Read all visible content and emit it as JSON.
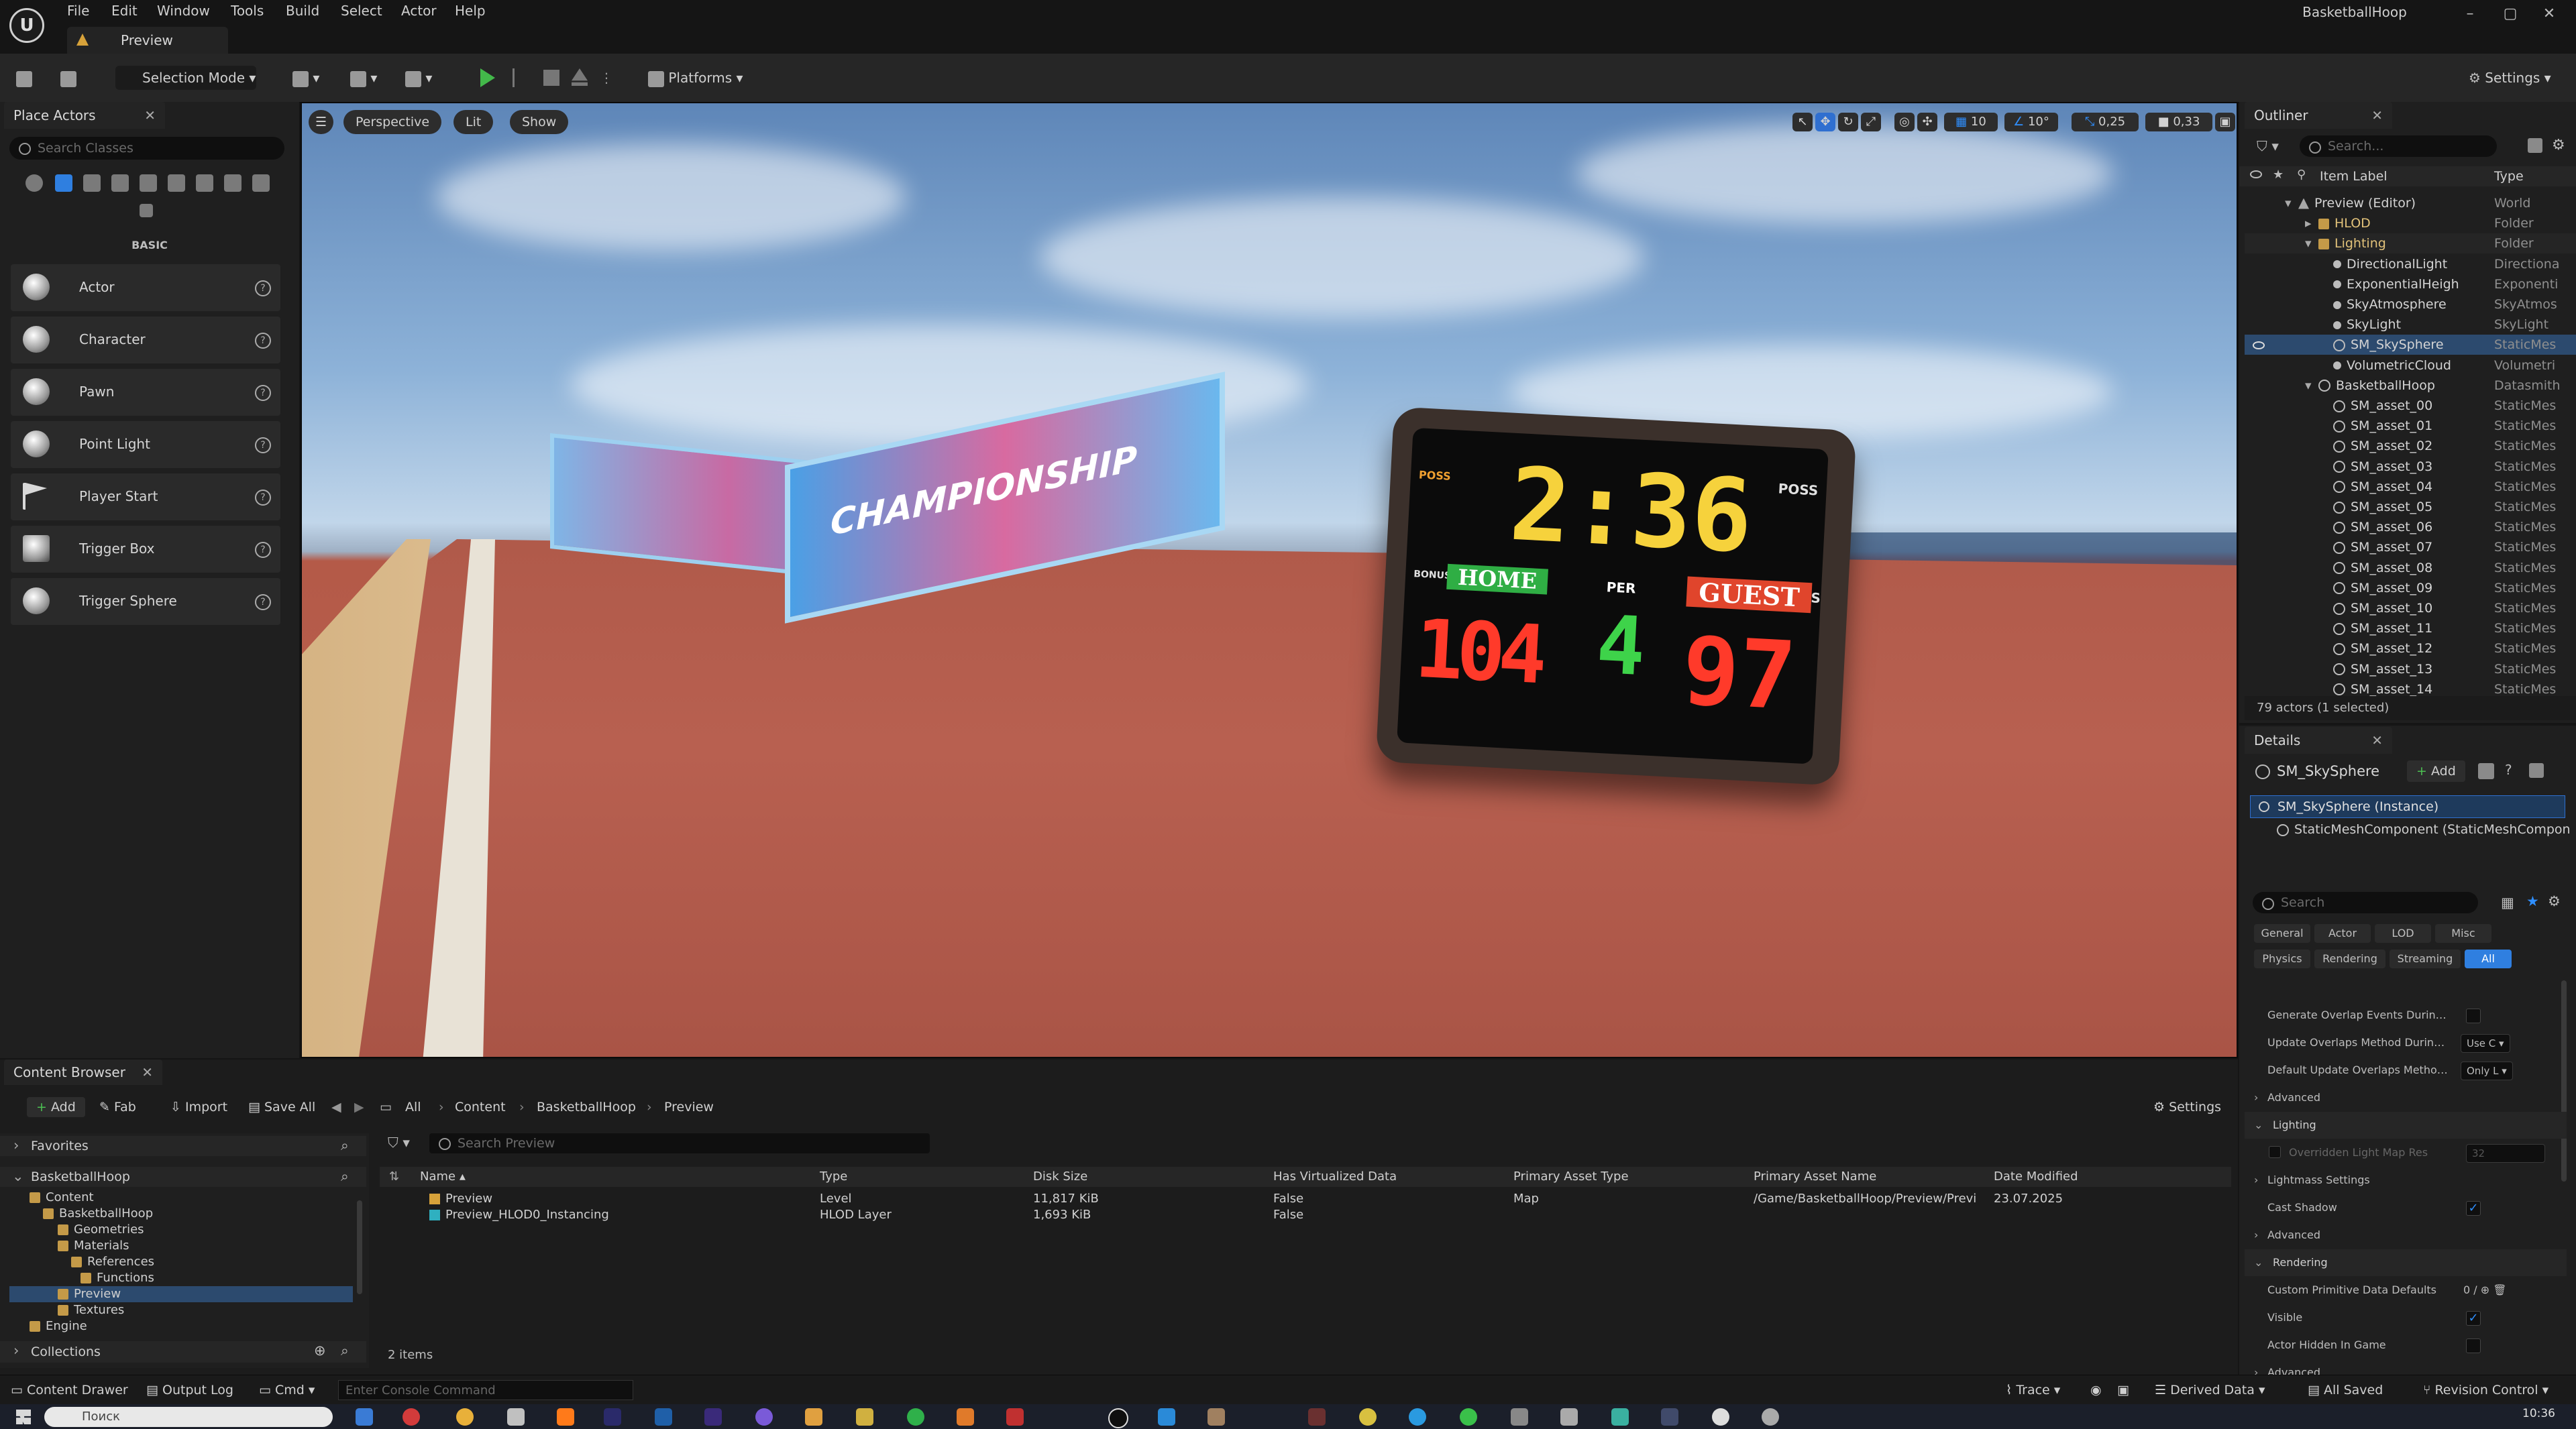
{
  "menu": [
    "File",
    "Edit",
    "Window",
    "Tools",
    "Build",
    "Select",
    "Actor",
    "Help"
  ],
  "level_tab": "Preview",
  "project_name": "BasketballHoop",
  "window_controls": [
    "–",
    "▢",
    "✕"
  ],
  "toolbar": {
    "selection_mode": "Selection Mode",
    "platforms": "Platforms",
    "settings": "Settings"
  },
  "place_actors": {
    "tab": "Place Actors",
    "search_placeholder": "Search Classes",
    "category": "BASIC",
    "items": [
      "Actor",
      "Character",
      "Pawn",
      "Point Light",
      "Player Start",
      "Trigger Box",
      "Trigger Sphere"
    ]
  },
  "viewport": {
    "view_mode": "Perspective",
    "lighting": "Lit",
    "show": "Show",
    "grid_snap": "10",
    "rotation_snap": "10°",
    "scale_snap": "0,25",
    "camera_speed": "0,33",
    "banner_text": "CHAMPIONSHIP",
    "scoreboard": {
      "clock": "2:36",
      "home_label": "HOME",
      "guest_label": "GUEST",
      "period_label": "PER",
      "period": "4",
      "home_score": "104",
      "guest_score": "97",
      "poss": "POSS",
      "bonus": "BONUS"
    }
  },
  "outliner": {
    "tab": "Outliner",
    "search_placeholder": "Search...",
    "col_label": "Item Label",
    "col_type": "Type",
    "rows": [
      {
        "name": "Preview (Editor)",
        "type": "World"
      },
      {
        "name": "HLOD",
        "type": "Folder"
      },
      {
        "name": "Lighting",
        "type": "Folder"
      },
      {
        "name": "DirectionalLight",
        "type": "Directiona"
      },
      {
        "name": "ExponentialHeigh",
        "type": "Exponenti"
      },
      {
        "name": "SkyAtmosphere",
        "type": "SkyAtmos"
      },
      {
        "name": "SkyLight",
        "type": "SkyLight"
      },
      {
        "name": "SM_SkySphere",
        "type": "StaticMes"
      },
      {
        "name": "VolumetricCloud",
        "type": "Volumetri"
      },
      {
        "name": "BasketballHoop",
        "type": "Datasmith"
      },
      {
        "name": "SM_asset_00",
        "type": "StaticMes"
      },
      {
        "name": "SM_asset_01",
        "type": "StaticMes"
      },
      {
        "name": "SM_asset_02",
        "type": "StaticMes"
      },
      {
        "name": "SM_asset_03",
        "type": "StaticMes"
      },
      {
        "name": "SM_asset_04",
        "type": "StaticMes"
      },
      {
        "name": "SM_asset_05",
        "type": "StaticMes"
      },
      {
        "name": "SM_asset_06",
        "type": "StaticMes"
      },
      {
        "name": "SM_asset_07",
        "type": "StaticMes"
      },
      {
        "name": "SM_asset_08",
        "type": "StaticMes"
      },
      {
        "name": "SM_asset_09",
        "type": "StaticMes"
      },
      {
        "name": "SM_asset_10",
        "type": "StaticMes"
      },
      {
        "name": "SM_asset_11",
        "type": "StaticMes"
      },
      {
        "name": "SM_asset_12",
        "type": "StaticMes"
      },
      {
        "name": "SM_asset_13",
        "type": "StaticMes"
      },
      {
        "name": "SM_asset_14",
        "type": "StaticMes"
      }
    ],
    "footer": "79 actors (1 selected)"
  },
  "details": {
    "tab": "Details",
    "object_name": "SM_SkySphere",
    "add": "Add",
    "instance": "SM_SkySphere (Instance)",
    "component": "StaticMeshComponent (StaticMeshCompon",
    "search_placeholder": "Search",
    "filters_row1": [
      "General",
      "Actor",
      "LOD",
      "Misc"
    ],
    "filters_row2": [
      "Physics",
      "Rendering",
      "Streaming",
      "All"
    ],
    "props": [
      {
        "label": "Generate Overlap Events During Lev...",
        "kind": "check",
        "value": ""
      },
      {
        "label": "Update Overlaps Method During Lev...",
        "kind": "combo",
        "value": "Use C"
      },
      {
        "label": "Default Update Overlaps Method Du...",
        "kind": "combo",
        "value": "Only L"
      },
      {
        "label": "Advanced",
        "kind": "section",
        "value": ""
      },
      {
        "label": "Lighting",
        "kind": "header",
        "value": ""
      },
      {
        "label": "Overridden Light Map Res",
        "kind": "disabled",
        "value": "32"
      },
      {
        "label": "Lightmass Settings",
        "kind": "section",
        "value": ""
      },
      {
        "label": "Cast Shadow",
        "kind": "check",
        "value": "✓"
      },
      {
        "label": "Advanced",
        "kind": "section",
        "value": ""
      },
      {
        "label": "Rendering",
        "kind": "header",
        "value": ""
      },
      {
        "label": "Custom Primitive Data Defaults",
        "kind": "text",
        "value": "0 /"
      },
      {
        "label": "Visible",
        "kind": "check",
        "value": "✓"
      },
      {
        "label": "Actor Hidden In Game",
        "kind": "check",
        "value": ""
      },
      {
        "label": "Advanced",
        "kind": "section",
        "value": ""
      }
    ]
  },
  "content_browser": {
    "tab": "Content Browser",
    "add": "Add",
    "fab": "Fab",
    "import": "Import",
    "save_all": "Save All",
    "breadcrumb": [
      "All",
      "Content",
      "BasketballHoop",
      "Preview"
    ],
    "settings": "Settings",
    "favorites": "Favorites",
    "root": "BasketballHoop",
    "tree": [
      "Content",
      "BasketballHoop",
      "Geometries",
      "Materials",
      "References",
      "Functions",
      "Preview",
      "Textures",
      "Engine"
    ],
    "collections": "Collections",
    "search_placeholder": "Search Preview",
    "columns": [
      "Name",
      "Type",
      "Disk Size",
      "Has Virtualized Data",
      "Primary Asset Type",
      "Primary Asset Name",
      "Date Modified"
    ],
    "rows": [
      [
        "Preview",
        "Level",
        "11,817 KiB",
        "False",
        "Map",
        "/Game/BasketballHoop/Preview/Previ",
        "23.07.2025"
      ],
      [
        "Preview_HLOD0_Instancing",
        "HLOD Layer",
        "1,693 KiB",
        "False",
        "",
        "",
        ""
      ]
    ],
    "item_count": "2 items"
  },
  "statusbar": {
    "content_drawer": "Content Drawer",
    "output_log": "Output Log",
    "cmd": "Cmd",
    "console_placeholder": "Enter Console Command",
    "trace": "Trace",
    "derived_data": "Derived Data",
    "all_saved": "All Saved",
    "revision_control": "Revision Control"
  },
  "taskbar": {
    "search_placeholder": "Поиск",
    "time": "10:36"
  }
}
